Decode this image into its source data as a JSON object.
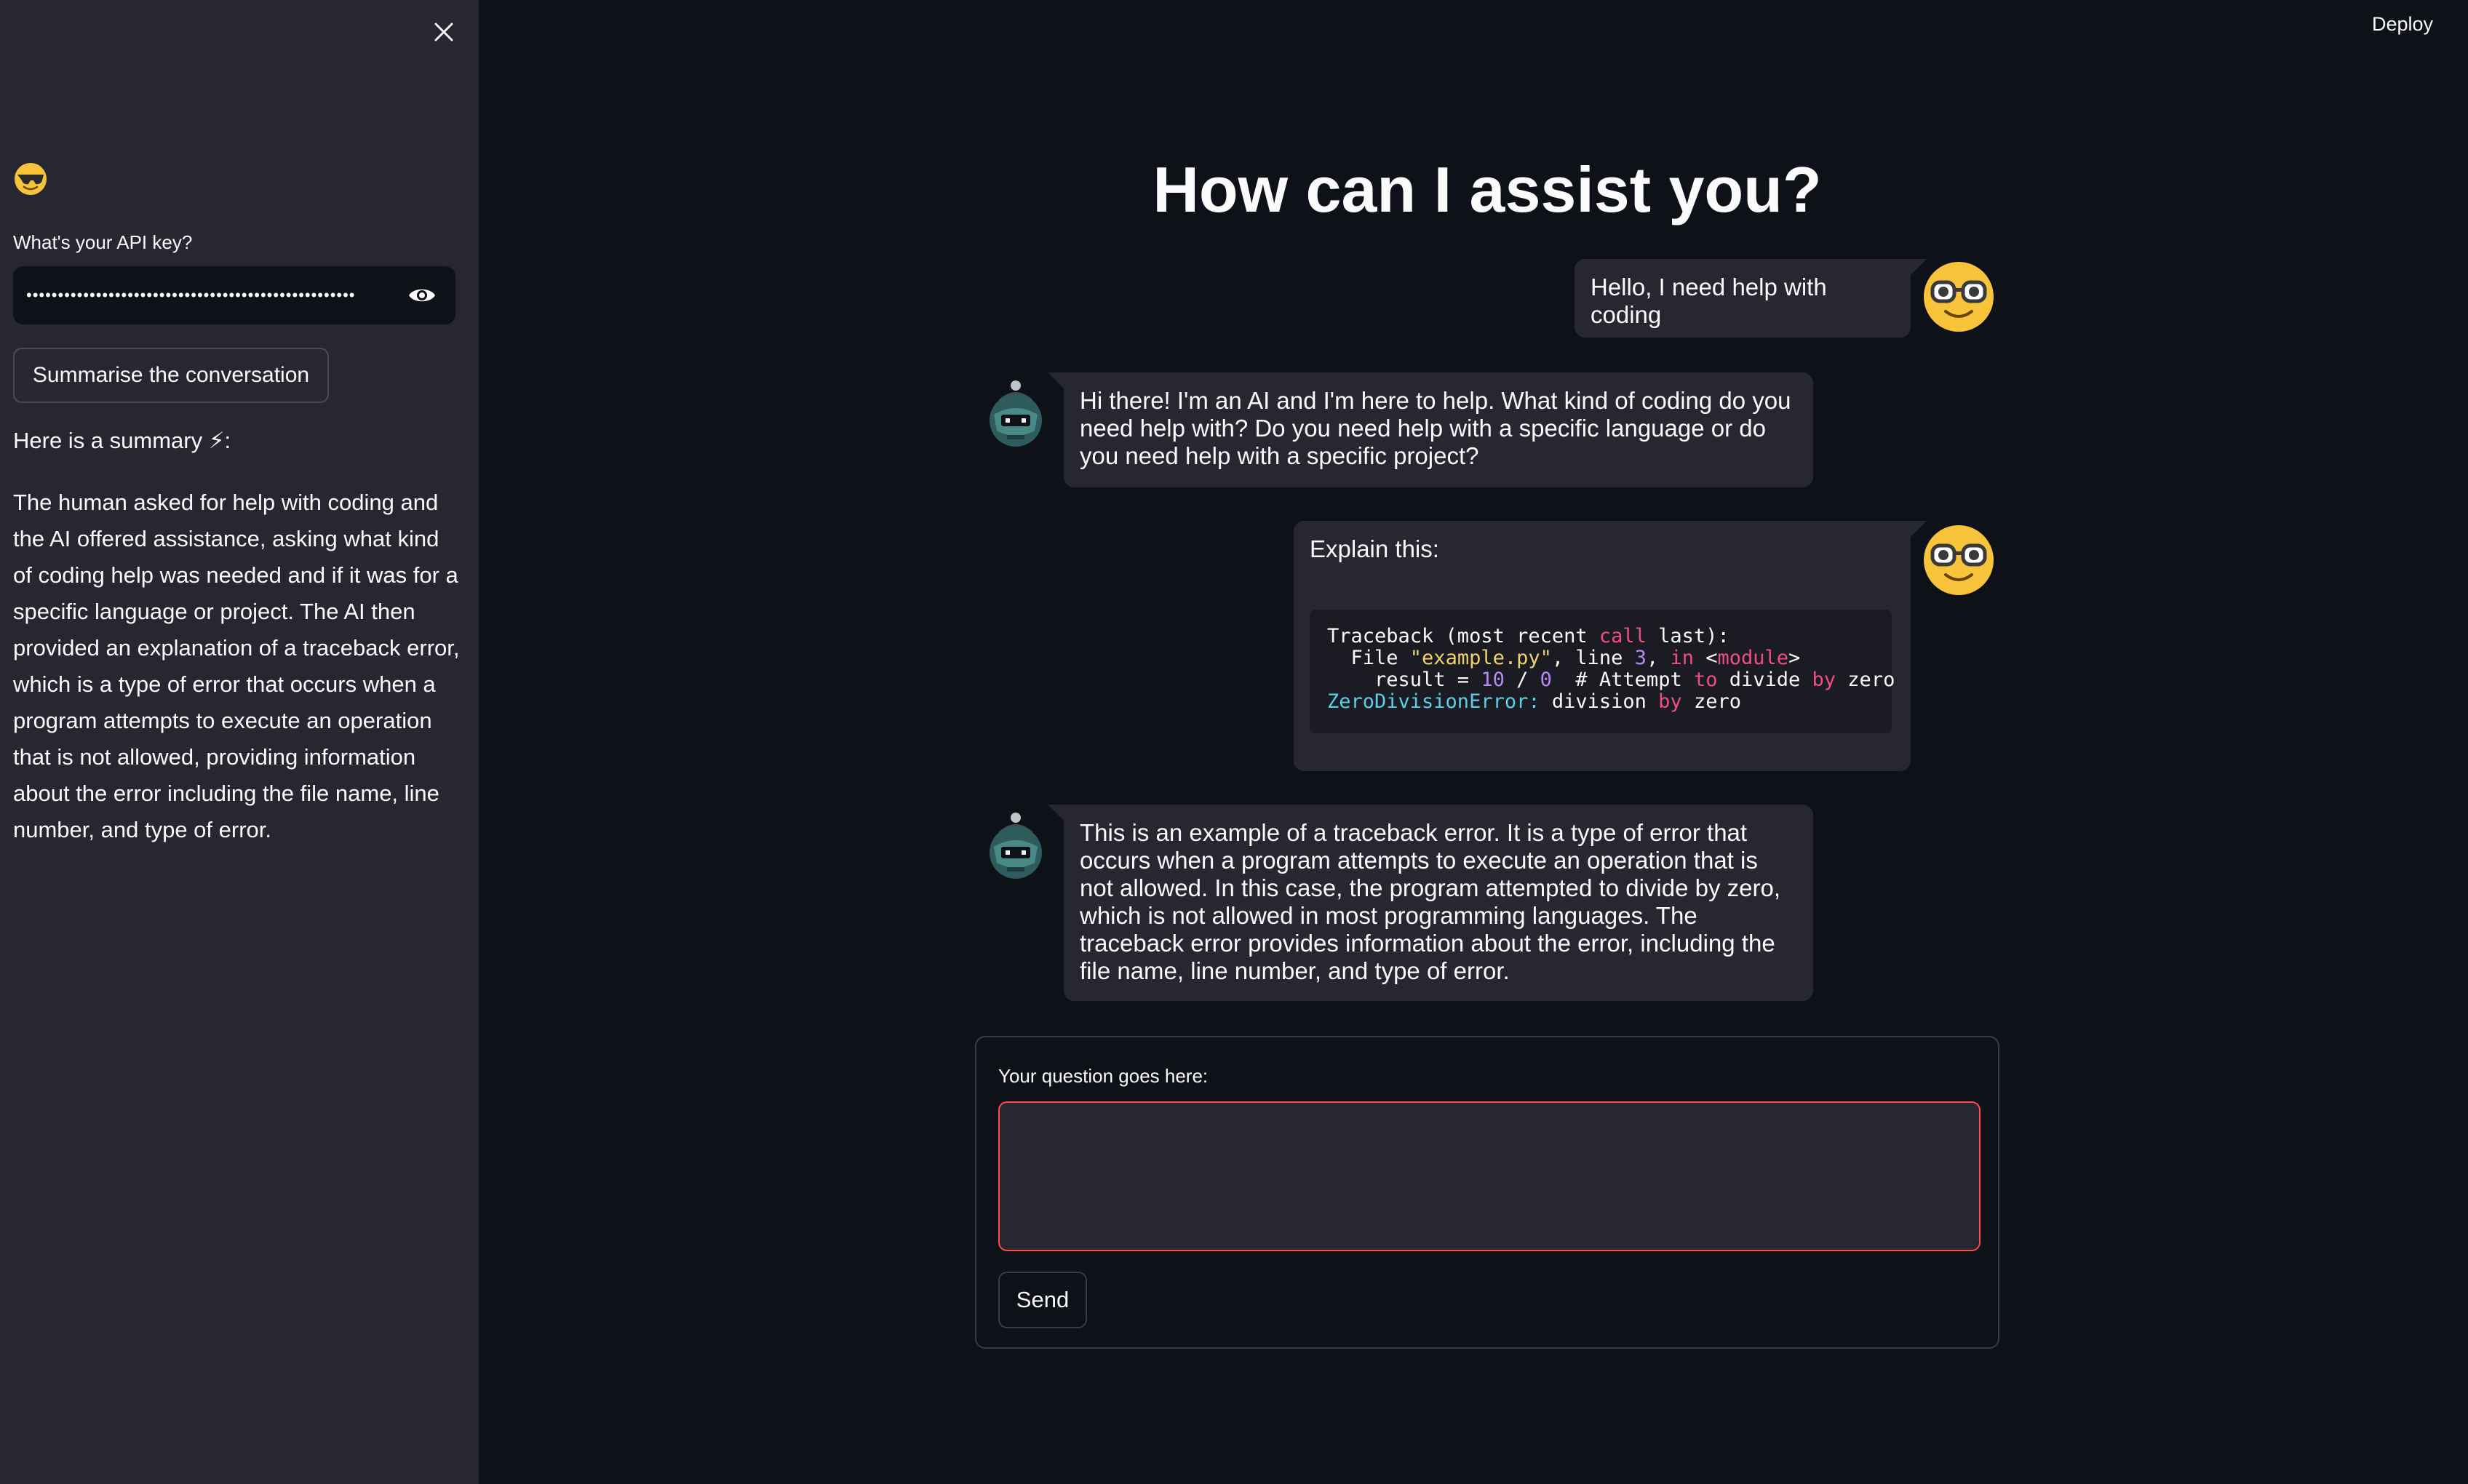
{
  "sidebar": {
    "close_icon": "close-icon",
    "emoji": "😎",
    "api_label": "What's your API key?",
    "api_key_masked": "••••••••••••••••••••••••••••••••••••••••••••••••••••",
    "eye_icon": "eye-icon",
    "summarise_button": "Summarise the conversation",
    "summary_heading": "Here is a summary ⚡:",
    "summary_text": "The human asked for help with coding and the AI offered assistance, asking what kind of coding help was needed and if it was for a specific language or project. The AI then provided an explanation of a traceback error, which is a type of error that occurs when a program attempts to execute an operation that is not allowed, providing information about the error including the file name, line number, and type of error."
  },
  "header": {
    "deploy_label": "Deploy"
  },
  "main": {
    "title": "How can I assist you?",
    "messages": [
      {
        "role": "user",
        "avatar": "nerd-face-icon",
        "text": "Hello, I need help with coding"
      },
      {
        "role": "ai",
        "avatar": "bot-icon",
        "text": "Hi there! I'm an AI and I'm here to help. What kind of coding do you need help with? Do you need help with a specific language or do you need help with a specific project?"
      },
      {
        "role": "user",
        "avatar": "nerd-face-icon",
        "text": "Explain this:",
        "code": [
          "Traceback (most recent call last):",
          "  File \"example.py\", line 3, in <module>",
          "    result = 10 / 0  # Attempt to divide by zero",
          "ZeroDivisionError: division by zero"
        ]
      },
      {
        "role": "ai",
        "avatar": "bot-icon",
        "text": "This is an example of a traceback error. It is a type of error that occurs when a program attempts to execute an operation that is not allowed. In this case, the program attempted to divide by zero, which is not allowed in most programming languages. The traceback error provides information about the error, including the file name, line number, and type of error."
      }
    ],
    "form": {
      "question_label": "Your question goes here:",
      "question_value": "",
      "send_button": "Send"
    }
  },
  "colors": {
    "background": "#0e1117",
    "sidebar": "#262730",
    "bubble": "#262730",
    "accent_red": "#ff4b4b"
  }
}
